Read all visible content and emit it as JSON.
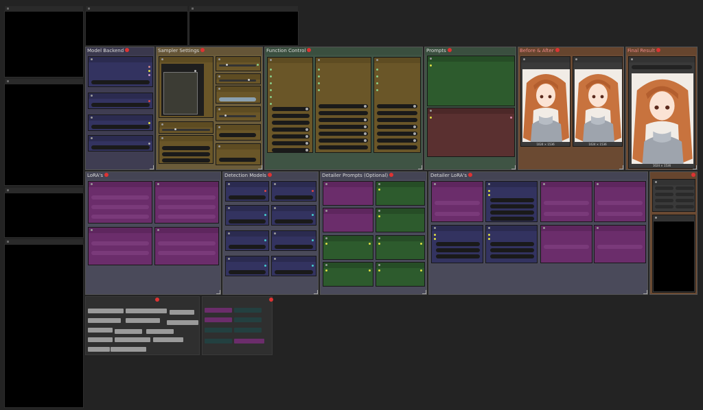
{
  "groups": {
    "model_backend": "Model Backend",
    "sampler_settings": "Sampler Settings",
    "function_control": "Function Control",
    "prompts": "Prompts",
    "before_after": "Before & After",
    "final_result": "Final Result",
    "loras": "LoRA's",
    "detection_models": "Detection Models",
    "detailer_prompts": "Detailer Prompts (Optional)",
    "detailer_loras": "Detailer LoRA's"
  },
  "images": {
    "before_caption": "1024 × 1536",
    "after_caption": "1024 × 1536",
    "final_caption": "1024 × 1536"
  },
  "colors": {
    "canvas": "#232323",
    "node_group_blue": "#3f3d52",
    "node_group_yellow": "#6b5c3a",
    "node_group_green": "#3f5444",
    "node_group_orange": "#6b4a32",
    "node_blue": "#333360",
    "node_yellow": "#6a5628",
    "node_green": "#2d5b2d",
    "node_red": "#5a3030",
    "node_purple": "#6b2d6b"
  },
  "icons": [
    "pin-icon",
    "node-collapse-dot-icon",
    "resize-handle-icon"
  ]
}
